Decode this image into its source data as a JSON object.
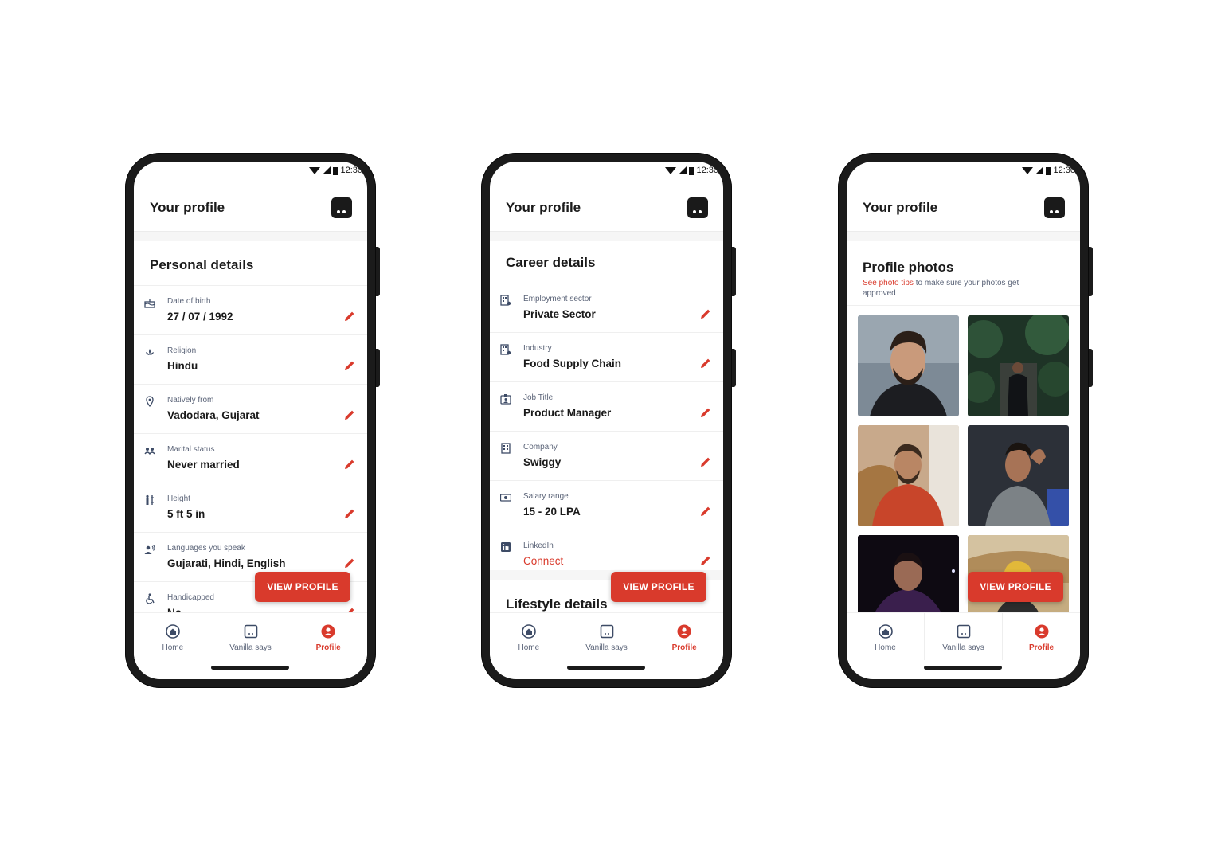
{
  "status": {
    "time": "12:30"
  },
  "colors": {
    "accent": "#d93a2c",
    "text": "#1a1a1a",
    "muted": "#5b6478"
  },
  "screens": [
    {
      "appbar_title": "Your profile",
      "section_title": "Personal details",
      "rows": [
        {
          "icon": "cake-icon",
          "label": "Date of birth",
          "value": "27 / 07 / 1992"
        },
        {
          "icon": "lotus-icon",
          "label": "Religion",
          "value": "Hindu"
        },
        {
          "icon": "location-pin-icon",
          "label": "Natively from",
          "value": "Vadodara, Gujarat"
        },
        {
          "icon": "couple-icon",
          "label": "Marital status",
          "value": "Never married"
        },
        {
          "icon": "height-icon",
          "label": "Height",
          "value": "5 ft 5 in"
        },
        {
          "icon": "speaking-person-icon",
          "label": "Languages you speak",
          "value": "Gujarati, Hindi, English"
        },
        {
          "icon": "wheelchair-icon",
          "label": "Handicapped",
          "value": "No"
        }
      ],
      "cta": "VIEW PROFILE"
    },
    {
      "appbar_title": "Your profile",
      "section_title": "Career details",
      "rows": [
        {
          "icon": "building-gear-icon",
          "label": "Employment sector",
          "value": "Private Sector"
        },
        {
          "icon": "building-gear-icon",
          "label": "Industry",
          "value": "Food Supply Chain"
        },
        {
          "icon": "id-badge-icon",
          "label": "Job Title",
          "value": "Product Manager"
        },
        {
          "icon": "office-building-icon",
          "label": "Company",
          "value": "Swiggy"
        },
        {
          "icon": "money-icon",
          "label": "Salary range",
          "value": "15 - 20 LPA"
        },
        {
          "icon": "linkedin-icon",
          "label": "LinkedIn",
          "value": "Connect"
        }
      ],
      "next_section": "Lifestyle details",
      "cta": "VIEW PROFILE"
    },
    {
      "appbar_title": "Your profile",
      "section_title": "Profile photos",
      "subtitle_link": "See photo tips",
      "subtitle_rest": " to make sure your photos get approved",
      "photos": [
        "man-in-black-hoodie-photo",
        "man-in-forest-photo",
        "man-in-red-sweater-photo",
        "man-in-grey-tshirt-photo",
        "man-at-night-photo",
        "man-at-fort-photo"
      ],
      "cta": "VIEW PROFILE"
    }
  ],
  "nav": {
    "home": "Home",
    "vanilla": "Vanilla says",
    "profile": "Profile"
  }
}
